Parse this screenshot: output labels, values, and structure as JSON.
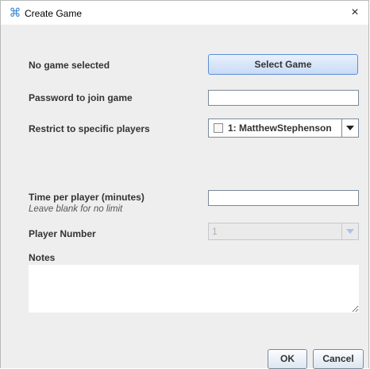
{
  "window": {
    "title": "Create Game",
    "close_label": "×"
  },
  "form": {
    "game_status_label": "No game selected",
    "select_game_label": "Select Game",
    "password_label": "Password to join game",
    "password_value": "",
    "restrict_label": "Restrict to specific players",
    "restrict_selected": "1: MatthewStephenson",
    "restrict_checked": false,
    "time_label": "Time per player (minutes)",
    "time_hint": "Leave blank for no limit",
    "time_value": "",
    "player_number_label": "Player Number",
    "player_number_value": "1",
    "notes_label": "Notes",
    "notes_value": ""
  },
  "buttons": {
    "ok": "OK",
    "cancel": "Cancel"
  },
  "icons": {
    "app": "command-icon",
    "close": "close-icon",
    "dropdown": "chevron-down-icon"
  },
  "colors": {
    "accent": "#3a86d6",
    "dialog_bg": "#eeeeee"
  }
}
